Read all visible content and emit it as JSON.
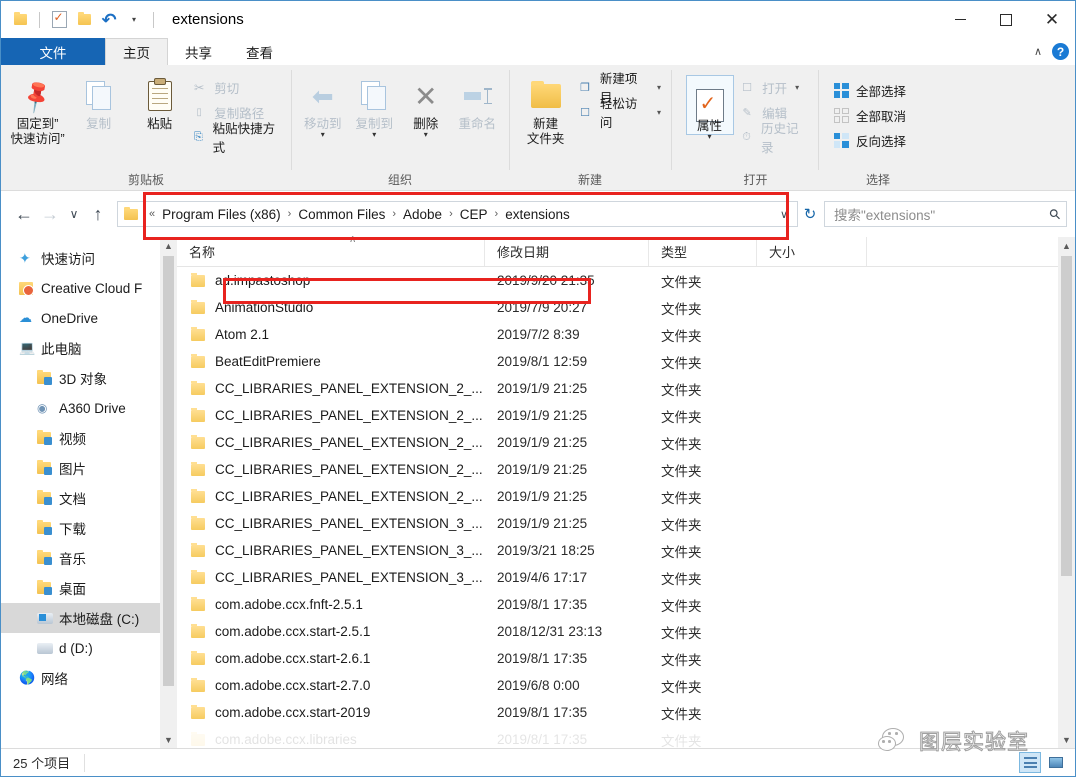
{
  "window": {
    "title": "extensions",
    "controls": {
      "minimize": "—",
      "maximize": "□",
      "close": "✕"
    }
  },
  "quick_access_toolbar": {
    "items": [
      {
        "name": "folder-icon",
        "label": ""
      },
      {
        "name": "properties-icon",
        "label": ""
      },
      {
        "name": "new-folder-icon",
        "label": ""
      },
      {
        "name": "undo-icon",
        "label": "↶"
      },
      {
        "name": "customize-caret-icon",
        "label": "▾"
      }
    ]
  },
  "tabs": [
    {
      "id": "file",
      "label": "文件"
    },
    {
      "id": "home",
      "label": "主页"
    },
    {
      "id": "share",
      "label": "共享"
    },
    {
      "id": "view",
      "label": "查看"
    }
  ],
  "tabbar_right": {
    "collapse_ribbon": "∧",
    "help": "?"
  },
  "ribbon": {
    "groups": [
      {
        "label": "剪贴板",
        "big_buttons": [
          {
            "name": "pin-to-quick-access",
            "line1": "固定到”",
            "line2": "快速访问”"
          },
          {
            "name": "copy",
            "line1": "复制",
            "line2": ""
          },
          {
            "name": "paste",
            "line1": "粘贴",
            "line2": ""
          }
        ],
        "small_buttons": [
          {
            "name": "cut",
            "label": "剪切",
            "disabled": true
          },
          {
            "name": "copy-path",
            "label": "复制路径",
            "disabled": true
          },
          {
            "name": "paste-shortcut",
            "label": "粘贴快捷方式",
            "disabled": false
          }
        ]
      },
      {
        "label": "组织",
        "big_buttons": [
          {
            "name": "move-to",
            "line1": "移动到",
            "line2": ""
          },
          {
            "name": "copy-to",
            "line1": "复制到",
            "line2": ""
          },
          {
            "name": "delete",
            "line1": "删除",
            "line2": ""
          },
          {
            "name": "rename",
            "line1": "重命名",
            "line2": ""
          }
        ],
        "small_buttons": []
      },
      {
        "label": "新建",
        "big_buttons": [
          {
            "name": "new-folder",
            "line1": "新建",
            "line2": "文件夹"
          }
        ],
        "small_buttons": [
          {
            "name": "new-item",
            "label": "新建项目",
            "disabled": false
          },
          {
            "name": "easy-access",
            "label": "轻松访问",
            "disabled": false
          }
        ]
      },
      {
        "label": "打开",
        "big_buttons": [
          {
            "name": "properties",
            "line1": "属性",
            "line2": ""
          }
        ],
        "small_buttons": [
          {
            "name": "open",
            "label": "打开",
            "disabled": true
          },
          {
            "name": "edit",
            "label": "编辑",
            "disabled": true
          },
          {
            "name": "history",
            "label": "历史记录",
            "disabled": true
          }
        ]
      },
      {
        "label": "选择",
        "big_buttons": [],
        "small_buttons": [
          {
            "name": "select-all",
            "label": "全部选择",
            "disabled": false
          },
          {
            "name": "select-none",
            "label": "全部取消",
            "disabled": false
          },
          {
            "name": "invert-selection",
            "label": "反向选择",
            "disabled": false
          }
        ]
      }
    ]
  },
  "addressbar": {
    "back": "←",
    "forward": "→",
    "recent": "∨",
    "up": "↑",
    "overflow": "«",
    "breadcrumbs": [
      "Program Files (x86)",
      "Common Files",
      "Adobe",
      "CEP",
      "extensions"
    ],
    "separator": "›",
    "dropdown": "∨",
    "refresh": "↻"
  },
  "search": {
    "placeholder": "搜索\"extensions\"",
    "icon": "search-icon"
  },
  "sidebar": {
    "items": [
      {
        "label": "快速访问",
        "icon": "star-icon",
        "indent": 0,
        "selected": false
      },
      {
        "label": "Creative Cloud F",
        "icon": "creative-cloud-icon",
        "indent": 0,
        "selected": false
      },
      {
        "label": "OneDrive",
        "icon": "cloud-icon",
        "indent": 0,
        "selected": false
      },
      {
        "label": "此电脑",
        "icon": "this-pc-icon",
        "indent": 0,
        "selected": false
      },
      {
        "label": "3D 对象",
        "icon": "folder-3d-icon",
        "indent": 1,
        "selected": false
      },
      {
        "label": "A360 Drive",
        "icon": "a360-icon",
        "indent": 1,
        "selected": false
      },
      {
        "label": "视频",
        "icon": "folder-video-icon",
        "indent": 1,
        "selected": false
      },
      {
        "label": "图片",
        "icon": "folder-pictures-icon",
        "indent": 1,
        "selected": false
      },
      {
        "label": "文档",
        "icon": "folder-documents-icon",
        "indent": 1,
        "selected": false
      },
      {
        "label": "下载",
        "icon": "folder-downloads-icon",
        "indent": 1,
        "selected": false
      },
      {
        "label": "音乐",
        "icon": "folder-music-icon",
        "indent": 1,
        "selected": false
      },
      {
        "label": "桌面",
        "icon": "folder-desktop-icon",
        "indent": 1,
        "selected": false
      },
      {
        "label": "本地磁盘 (C:)",
        "icon": "local-disk-icon",
        "indent": 1,
        "selected": true
      },
      {
        "label": "d (D:)",
        "icon": "drive-icon",
        "indent": 1,
        "selected": false
      },
      {
        "label": "网络",
        "icon": "network-icon",
        "indent": 0,
        "selected": false
      }
    ]
  },
  "filelist": {
    "columns": [
      {
        "key": "name",
        "label": "名称"
      },
      {
        "key": "date",
        "label": "修改日期"
      },
      {
        "key": "type",
        "label": "类型"
      },
      {
        "key": "size",
        "label": "大小"
      }
    ],
    "sort_indicator": "∧",
    "rows": [
      {
        "name": "ad.impastoshop",
        "date": "2019/9/20 21:35",
        "type": "文件夹",
        "size": ""
      },
      {
        "name": "AnimationStudio",
        "date": "2019/7/9 20:27",
        "type": "文件夹",
        "size": ""
      },
      {
        "name": "Atom 2.1",
        "date": "2019/7/2 8:39",
        "type": "文件夹",
        "size": ""
      },
      {
        "name": "BeatEditPremiere",
        "date": "2019/8/1 12:59",
        "type": "文件夹",
        "size": ""
      },
      {
        "name": "CC_LIBRARIES_PANEL_EXTENSION_2_...",
        "date": "2019/1/9 21:25",
        "type": "文件夹",
        "size": ""
      },
      {
        "name": "CC_LIBRARIES_PANEL_EXTENSION_2_...",
        "date": "2019/1/9 21:25",
        "type": "文件夹",
        "size": ""
      },
      {
        "name": "CC_LIBRARIES_PANEL_EXTENSION_2_...",
        "date": "2019/1/9 21:25",
        "type": "文件夹",
        "size": ""
      },
      {
        "name": "CC_LIBRARIES_PANEL_EXTENSION_2_...",
        "date": "2019/1/9 21:25",
        "type": "文件夹",
        "size": ""
      },
      {
        "name": "CC_LIBRARIES_PANEL_EXTENSION_2_...",
        "date": "2019/1/9 21:25",
        "type": "文件夹",
        "size": ""
      },
      {
        "name": "CC_LIBRARIES_PANEL_EXTENSION_3_...",
        "date": "2019/1/9 21:25",
        "type": "文件夹",
        "size": ""
      },
      {
        "name": "CC_LIBRARIES_PANEL_EXTENSION_3_...",
        "date": "2019/3/21 18:25",
        "type": "文件夹",
        "size": ""
      },
      {
        "name": "CC_LIBRARIES_PANEL_EXTENSION_3_...",
        "date": "2019/4/6 17:17",
        "type": "文件夹",
        "size": ""
      },
      {
        "name": "com.adobe.ccx.fnft-2.5.1",
        "date": "2019/8/1 17:35",
        "type": "文件夹",
        "size": ""
      },
      {
        "name": "com.adobe.ccx.start-2.5.1",
        "date": "2018/12/31 23:13",
        "type": "文件夹",
        "size": ""
      },
      {
        "name": "com.adobe.ccx.start-2.6.1",
        "date": "2019/8/1 17:35",
        "type": "文件夹",
        "size": ""
      },
      {
        "name": "com.adobe.ccx.start-2.7.0",
        "date": "2019/6/8 0:00",
        "type": "文件夹",
        "size": ""
      },
      {
        "name": "com.adobe.ccx.start-2019",
        "date": "2019/8/1 17:35",
        "type": "文件夹",
        "size": ""
      },
      {
        "name": "com.adobe.ccx.libraries",
        "date": "2019/8/1 17:35",
        "type": "文件夹",
        "size": ""
      }
    ]
  },
  "statusbar": {
    "item_count": "25 个项目",
    "views": [
      {
        "name": "details-view-button",
        "active": true
      },
      {
        "name": "thumbnail-view-button",
        "active": false
      }
    ]
  },
  "watermark": {
    "text": "图层实验室"
  },
  "annotations": {
    "highlight_color": "#e8231f",
    "boxes": [
      {
        "name": "address-path-highlight"
      },
      {
        "name": "first-row-highlight"
      }
    ]
  }
}
